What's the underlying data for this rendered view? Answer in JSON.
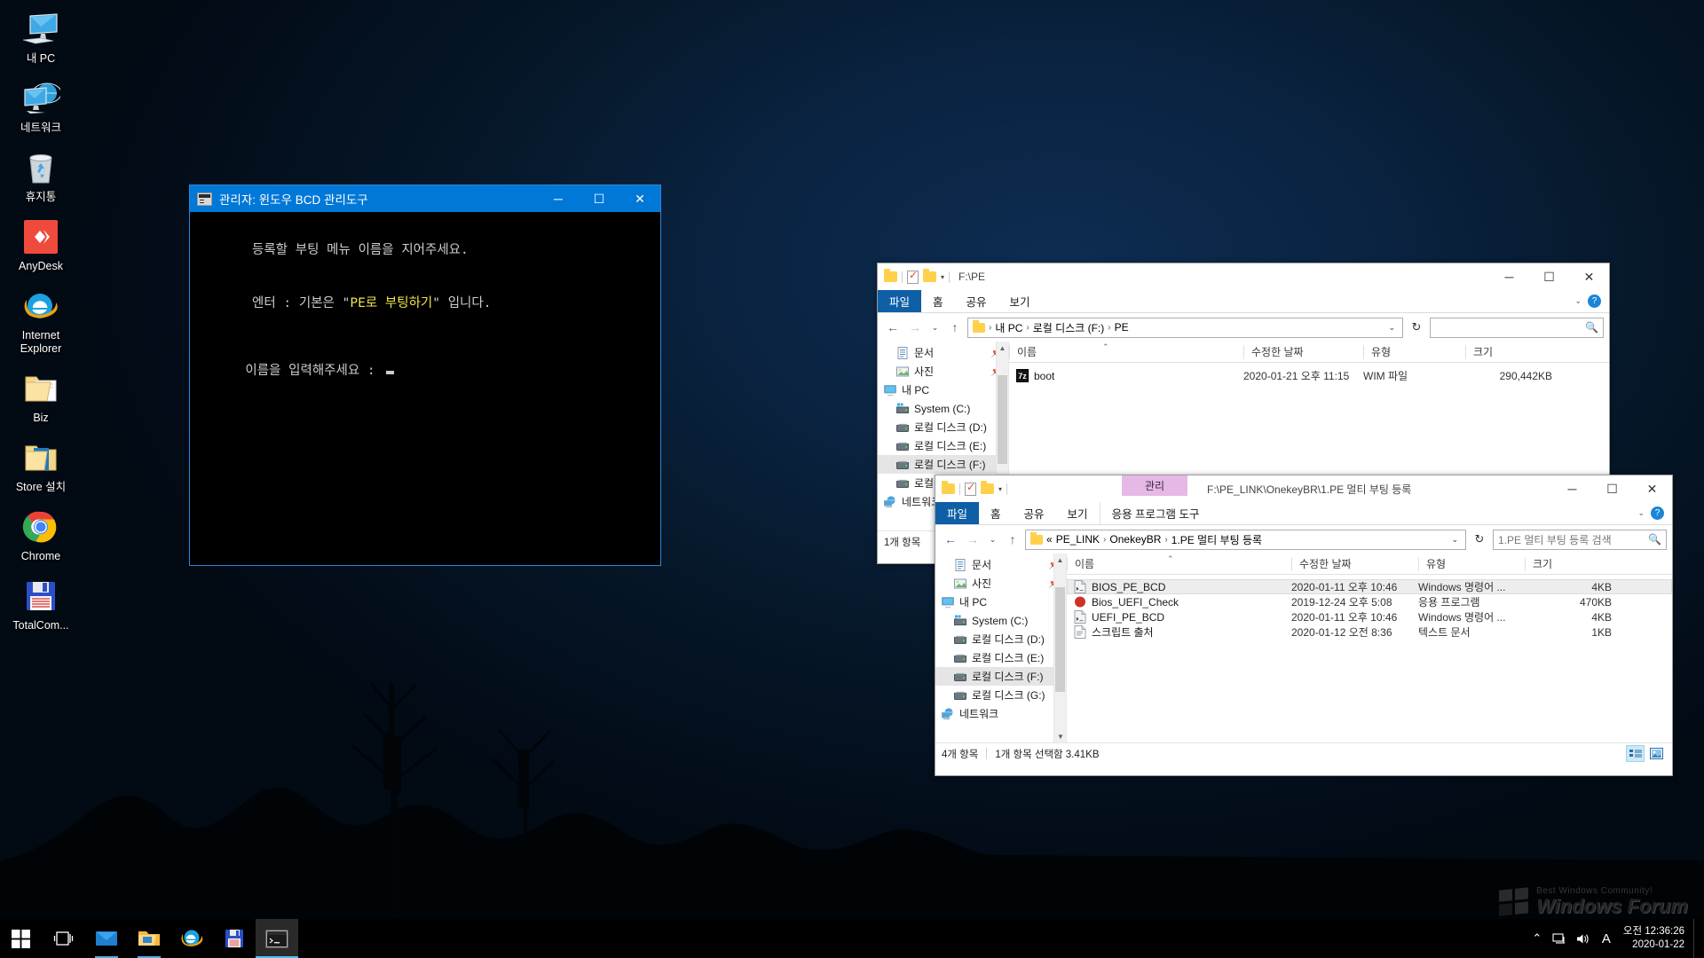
{
  "desktop": {
    "icons": [
      {
        "name": "내 PC",
        "icon": "my-pc-icon"
      },
      {
        "name": "네트워크",
        "icon": "network-icon"
      },
      {
        "name": "휴지통",
        "icon": "recycle-bin-icon"
      },
      {
        "name": "AnyDesk",
        "icon": "anydesk-icon"
      },
      {
        "name": "Internet Explorer",
        "icon": "internet-explorer-icon"
      },
      {
        "name": "Biz",
        "icon": "folder-icon"
      },
      {
        "name": "Store 설치",
        "icon": "store-folder-icon"
      },
      {
        "name": "Chrome",
        "icon": "chrome-icon"
      },
      {
        "name": "TotalCom...",
        "icon": "floppy-disk-icon"
      }
    ]
  },
  "console": {
    "title": "관리자:  윈도우 BCD 관리도구",
    "lines": [
      {
        "text": "등록할 부팅 메뉴 이름을 지어주세요."
      },
      {
        "text": ""
      },
      {
        "text": "엔터 : 기본은 \"PE로 부팅하기\" 입니다.",
        "highlight": "PE로 부팅하기"
      }
    ],
    "prompt": "이름을 입력해주세요 : ",
    "minimize_label": "─",
    "maximize_label": "☐",
    "close_label": "✕"
  },
  "explorer1": {
    "title_path": "F:\\PE",
    "ribbon_tabs": [
      "파일",
      "홈",
      "공유",
      "보기"
    ],
    "help_label": "?",
    "ribbon_collapse": "⌄",
    "breadcrumb": [
      "내 PC",
      "로컬 디스크 (F:)",
      "PE"
    ],
    "search_placeholder": "",
    "refresh_label": "↻",
    "back_label": "←",
    "forward_label": "→",
    "recent_label": "⌄",
    "up_label": "↑",
    "sidebar": [
      {
        "label": "문서",
        "icon": "document-icon",
        "pinned": true,
        "indent": 1
      },
      {
        "label": "사진",
        "icon": "pictures-icon",
        "pinned": true,
        "indent": 1
      },
      {
        "label": "내 PC",
        "icon": "my-pc-icon",
        "indent": 0
      },
      {
        "label": "System (C:)",
        "icon": "system-drive-icon",
        "indent": 1
      },
      {
        "label": "로컬 디스크 (D:)",
        "icon": "drive-icon",
        "indent": 1
      },
      {
        "label": "로컬 디스크 (E:)",
        "icon": "drive-icon",
        "indent": 1
      },
      {
        "label": "로컬 디스크 (F:)",
        "icon": "drive-icon",
        "indent": 1,
        "selected": true
      },
      {
        "label": "로컬 디스크 (G:)",
        "icon": "drive-icon",
        "indent": 1
      },
      {
        "label": "네트워크",
        "icon": "network-icon",
        "indent": 0
      }
    ],
    "columns": [
      "이름",
      "수정한 날짜",
      "유형",
      "크기"
    ],
    "rows": [
      {
        "name": "boot",
        "date": "2020-01-21 오후 11:15",
        "type": "WIM 파일",
        "size": "290,442KB",
        "icon": "archive-7z-icon"
      }
    ],
    "status": "1개 항목",
    "minimize_label": "─",
    "maximize_label": "☐",
    "close_label": "✕"
  },
  "explorer2": {
    "title_path": "F:\\PE_LINK\\OnekeyBR\\1.PE 멀티 부팅 등록",
    "context_tab": "관리",
    "ribbon_tabs": [
      "파일",
      "홈",
      "공유",
      "보기"
    ],
    "ribbon_context_tab": "응용 프로그램 도구",
    "help_label": "?",
    "ribbon_collapse": "⌄",
    "breadcrumb_prefix": "«",
    "breadcrumb": [
      "PE_LINK",
      "OnekeyBR",
      "1.PE 멀티 부팅 등록"
    ],
    "search_placeholder": "1.PE 멀티 부팅 등록 검색",
    "refresh_label": "↻",
    "back_label": "←",
    "forward_label": "→",
    "recent_label": "⌄",
    "up_label": "↑",
    "sidebar": [
      {
        "label": "문서",
        "icon": "document-icon",
        "pinned": true,
        "indent": 1
      },
      {
        "label": "사진",
        "icon": "pictures-icon",
        "pinned": true,
        "indent": 1
      },
      {
        "label": "내 PC",
        "icon": "my-pc-icon",
        "indent": 0
      },
      {
        "label": "System (C:)",
        "icon": "system-drive-icon",
        "indent": 1
      },
      {
        "label": "로컬 디스크 (D:)",
        "icon": "drive-icon",
        "indent": 1
      },
      {
        "label": "로컬 디스크 (E:)",
        "icon": "drive-icon",
        "indent": 1
      },
      {
        "label": "로컬 디스크 (F:)",
        "icon": "drive-icon",
        "indent": 1,
        "selected": true
      },
      {
        "label": "로컬 디스크 (G:)",
        "icon": "drive-icon",
        "indent": 1
      },
      {
        "label": "네트워크",
        "icon": "network-icon",
        "indent": 0
      }
    ],
    "columns": [
      "이름",
      "수정한 날짜",
      "유형",
      "크기"
    ],
    "rows": [
      {
        "name": "BIOS_PE_BCD",
        "date": "2020-01-11 오후 10:46",
        "type": "Windows 명령어 ...",
        "size": "4KB",
        "icon": "batch-file-icon",
        "selected": true
      },
      {
        "name": "Bios_UEFI_Check",
        "date": "2019-12-24 오후 5:08",
        "type": "응용 프로그램",
        "size": "470KB",
        "icon": "application-icon"
      },
      {
        "name": "UEFI_PE_BCD",
        "date": "2020-01-11 오후 10:46",
        "type": "Windows 명령어 ...",
        "size": "4KB",
        "icon": "batch-file-icon"
      },
      {
        "name": "스크립트 출처",
        "date": "2020-01-12 오전 8:36",
        "type": "텍스트 문서",
        "size": "1KB",
        "icon": "text-file-icon"
      }
    ],
    "status_count": "4개 항목",
    "status_selected": "1개 항목 선택함 3.41KB",
    "minimize_label": "─",
    "maximize_label": "☐",
    "close_label": "✕"
  },
  "taskbar": {
    "items": [
      {
        "icon": "start-icon",
        "name": "start-button"
      },
      {
        "icon": "task-view-icon",
        "name": "task-view-button"
      },
      {
        "icon": "blue-app-icon",
        "name": "taskbar-app-blue",
        "open": true
      },
      {
        "icon": "file-explorer-icon",
        "name": "taskbar-file-explorer",
        "open": true
      },
      {
        "icon": "internet-explorer-icon",
        "name": "taskbar-internet-explorer"
      },
      {
        "icon": "floppy-disk-icon",
        "name": "taskbar-total-commander"
      },
      {
        "icon": "command-prompt-icon",
        "name": "taskbar-command-prompt",
        "active": true
      }
    ],
    "tray": {
      "chevron": "⌃",
      "network_icon": "network-tray-icon",
      "volume_icon": "volume-tray-icon",
      "ime": "A",
      "time": "오전 12:36:26",
      "date": "2020-01-22"
    }
  },
  "watermark": {
    "top": "Best Windows Community!",
    "main": "Windows Forum"
  }
}
